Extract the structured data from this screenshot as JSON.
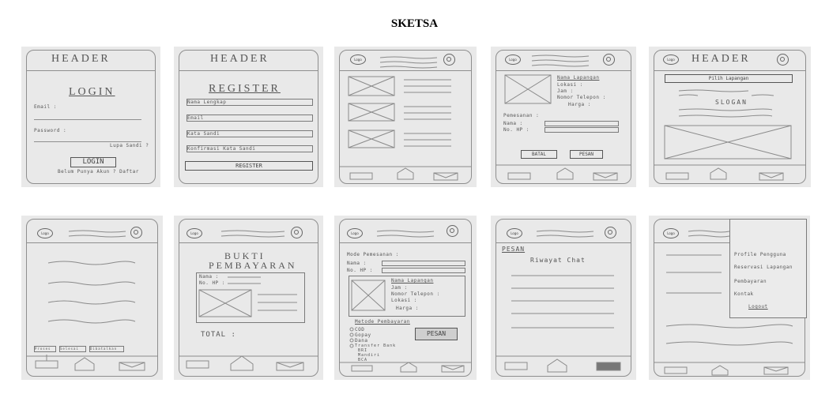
{
  "title": "SKETSA",
  "sketches": {
    "login": {
      "header": "HEADER",
      "heading": "LOGIN",
      "email_label": "Email :",
      "password_label": "Password :",
      "forgot_link": "Lupa Sandi ?",
      "login_button": "LOGIN",
      "register_hint": "Belum Punya Akun ? Daftar"
    },
    "register": {
      "header": "HEADER",
      "heading": "REGISTER",
      "fields": [
        "Nama Lengkap",
        "Email",
        "Kata Sandi",
        "Konfirmasi Kata Sandi"
      ],
      "register_button": "REGISTER"
    },
    "list": {
      "logo": "Logo"
    },
    "detail": {
      "logo": "Logo",
      "info": [
        "Nama Lapangan",
        "Lokasi :",
        "Jam :",
        "Nomor Telepon :",
        "Harga :"
      ],
      "section_label": "Pemesanan :",
      "form_fields": [
        "Nama :",
        "No. HP :"
      ],
      "cancel_button": "BATAL",
      "order_button": "PESAN"
    },
    "home": {
      "logo": "Logo",
      "header": "HEADER",
      "choose_button": "Pilih Lapangan",
      "slogan": "SLOGAN"
    },
    "history": {
      "logo": "Logo",
      "tabs": [
        "Proses",
        "Selesai",
        "Dibatalkan"
      ]
    },
    "proof": {
      "logo": "Logo",
      "heading_line1": "BUKTI",
      "heading_line2": "PEMBAYARAN",
      "fields": [
        "Nama :",
        "No. HP :"
      ],
      "total_label": "TOTAL :"
    },
    "order_detail": {
      "logo": "Logo",
      "section_label": "Mode Pemesanan :",
      "form_fields": [
        "Nama :",
        "No. HP :"
      ],
      "info": [
        "Nama Lapangan",
        "Jam :",
        "Nomor Telepon :",
        "Lokasi :",
        "Harga :"
      ],
      "payment_label": "Metode Pembayaran",
      "payment_options": [
        "COD",
        "Gopay",
        "Dana",
        "Transfer Bank",
        "BRI",
        "Mandiri",
        "BCA"
      ],
      "order_button": "PESAN"
    },
    "chat": {
      "logo": "Logo",
      "back_label": "PESAN",
      "heading": "Riwayat Chat"
    },
    "menu": {
      "logo": "Logo",
      "items": [
        "Profile Pengguna",
        "Reservasi Lapangan",
        "Pembayaran",
        "Kontak"
      ],
      "logout": "Logout"
    }
  }
}
